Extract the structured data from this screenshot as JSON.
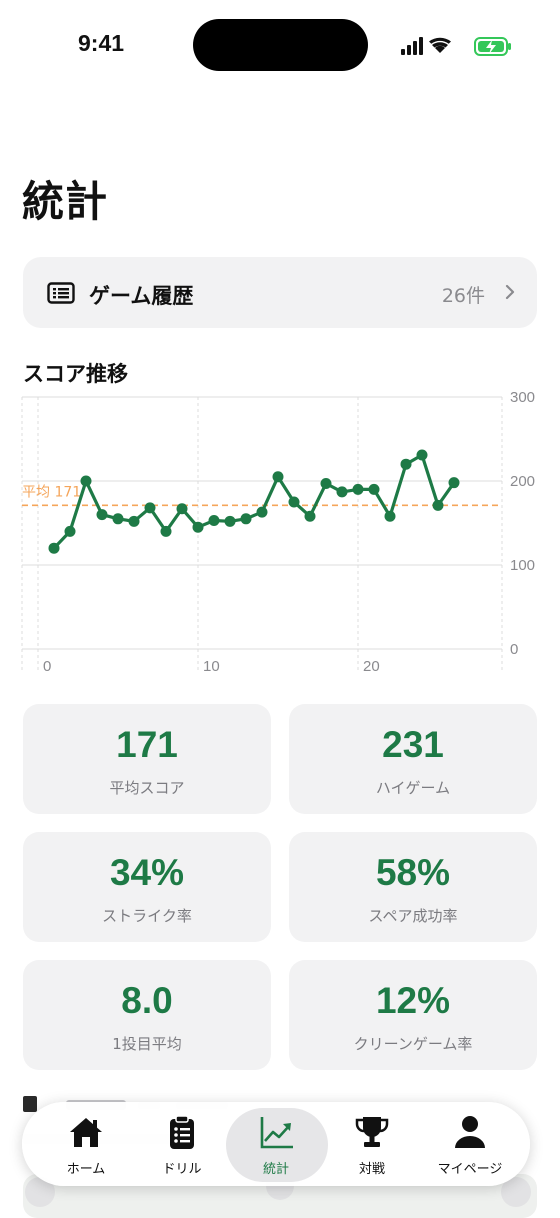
{
  "status_bar": {
    "time": "9:41"
  },
  "page": {
    "title": "統計"
  },
  "history": {
    "label": "ゲーム履歴",
    "count": "26件"
  },
  "chart_section": {
    "title": "スコア推移"
  },
  "chart_data": {
    "type": "line",
    "title": "",
    "xlabel": "",
    "ylabel": "",
    "x_ticks": [
      "0",
      "10",
      "20"
    ],
    "y_ticks": [
      "300",
      "200",
      "100",
      "0"
    ],
    "xlim": [
      -1,
      29
    ],
    "ylim": [
      0,
      300
    ],
    "average": {
      "label": "平均 171",
      "value": 171
    },
    "series": [
      {
        "x": [
          1,
          2,
          3,
          4,
          5,
          6,
          7,
          8,
          9,
          10,
          11,
          12,
          13,
          14,
          15,
          16,
          17,
          18,
          19,
          20,
          21,
          22,
          23,
          24,
          25,
          26
        ],
        "values": [
          120,
          140,
          200,
          160,
          155,
          152,
          168,
          140,
          167,
          145,
          153,
          152,
          155,
          163,
          205,
          175,
          158,
          197,
          187,
          190,
          190,
          158,
          220,
          231,
          171,
          198
        ]
      }
    ],
    "colors": {
      "line": "#1e7a46",
      "average": "#f5a55a",
      "grid": "#dcdcdc"
    }
  },
  "stats": [
    {
      "value": "171",
      "label": "平均スコア"
    },
    {
      "value": "231",
      "label": "ハイゲーム"
    },
    {
      "value": "34%",
      "label": "ストライク率"
    },
    {
      "value": "58%",
      "label": "スペア成功率"
    },
    {
      "value": "8.0",
      "label": "1投目平均"
    },
    {
      "value": "12%",
      "label": "クリーンゲーム率"
    }
  ],
  "tabs": [
    {
      "label": "ホーム",
      "icon": "house-icon"
    },
    {
      "label": "ドリル",
      "icon": "clipboard-list-icon"
    },
    {
      "label": "統計",
      "icon": "chart-line-icon",
      "active": true
    },
    {
      "label": "対戦",
      "icon": "trophy-icon"
    },
    {
      "label": "マイページ",
      "icon": "person-icon"
    }
  ],
  "theme": {
    "accent": "#1e7a46",
    "card_bg": "#f2f2f3"
  }
}
